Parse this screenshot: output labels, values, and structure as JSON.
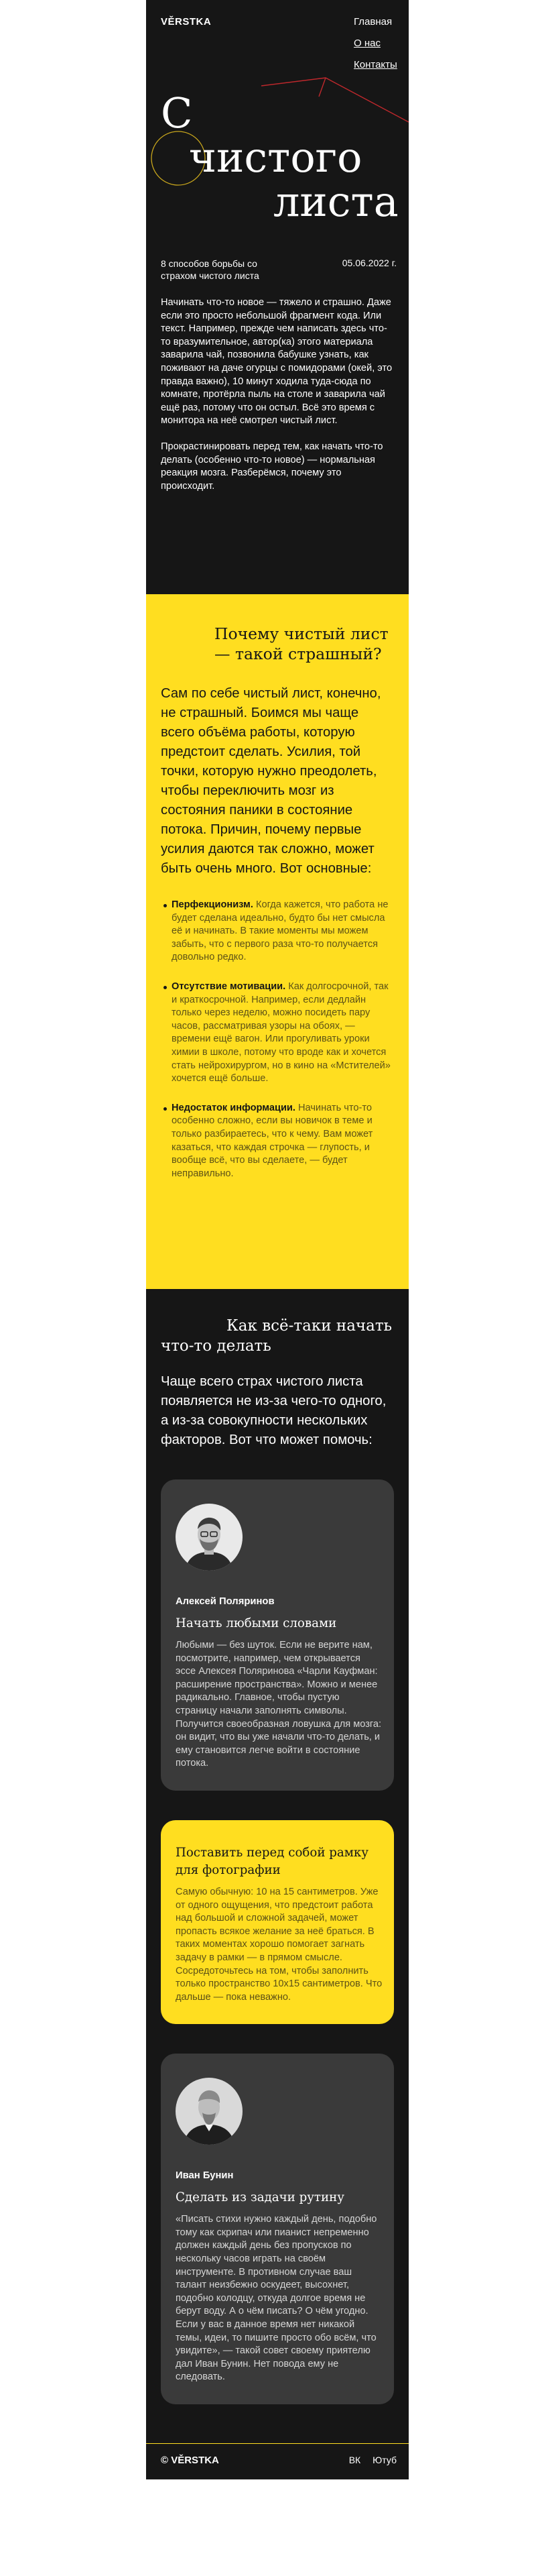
{
  "header": {
    "logo": "VĚRSTKA",
    "nav": [
      "Главная",
      "О нас",
      "Контакты"
    ],
    "title_lines": [
      "С",
      "чистого",
      "листа"
    ],
    "subtitle": "8 способов борьбы со страхом чистого листа",
    "date": "05.06.2022 г."
  },
  "intro": {
    "p1": "Начинать что-то новое — тяжело и страшно. Даже если это просто небольшой фрагмент кода. Или текст. Например, прежде чем написать здесь что-то вразумительное, автор(ка) этого материала заварила чай, позвонила бабушке узнать, как поживают на даче огурцы с помидорами (окей, это правда важно), 10 минут ходила туда-сюда по комнате, протёрла пыль на столе и заварила чай ещё раз, потому что он остыл. Всё это время с монитора на неё смотрел чистый лист.",
    "p2": "Прокрастинировать перед тем, как начать что-то делать (особенно что-то новое) — нормальная реакция мозга. Разберёмся, почему это происходит."
  },
  "why": {
    "heading": "Почему чистый лист — такой страшный?",
    "lead": "Сам по себе чистый лист, конечно, не страшный. Боимся мы чаще всего объёма работы, которую предстоит сделать. Усилия, той точки, которую нужно преодолеть, чтобы переключить мозг из состояния паники в состояние потока. Причин, почему первые усилия даются так сложно, может быть очень много. Вот основные:",
    "items": [
      {
        "term": "Перфекционизм.",
        "text": " Когда кажется, что работа не будет сделана идеально, будто бы нет смысла её и начинать. В такие моменты мы можем забыть, что с первого раза что-то получается довольно редко."
      },
      {
        "term": "Отсутствие мотивации.",
        "text": " Как долгосрочной, так и краткосрочной. Например, если дедлайн только через неделю, можно посидеть пару часов, рассматривая узоры на обоях, — времени ещё вагон. Или прогуливать уроки химии в школе, потому что вроде как и хочется стать нейрохирургом, но в кино на «Мстителей» хочется ещё больше."
      },
      {
        "term": "Недостаток информации.",
        "text": " Начинать что-то особенно сложно, если вы новичок в теме и только разбираетесь, что к чему. Вам может казаться, что каждая строчка — глупость, и вообще всё, что вы сделаете, — будет неправильно."
      }
    ]
  },
  "how": {
    "heading_l1": "Как всё-таки начать",
    "heading_l2": "что-то делать",
    "lead": "Чаще всего страх чистого листа появляется не из-за чего-то одного, а из-за совокупности нескольких факторов. Вот что может помочь:"
  },
  "cards": [
    {
      "author": "Алексей Поляринов",
      "title": "Начать любыми словами",
      "text": "Любыми — без шуток. Если не верите нам, посмотрите, например, чем открывается эссе Алексея Поляринова «Чарли Кауфман: расширение пространства». Можно и менее радикально. Главное, чтобы пустую страницу начали заполнять символы. Получится своеобразная ловушка для мозга: он видит, что вы уже начали что-то делать, и ему становится легче войти в состояние потока."
    },
    {
      "title": "Поставить перед собой рамку для фотографии",
      "text": "Самую обычную: 10 на 15 сантиметров. Уже от одного ощущения, что предстоит работа над большой и сложной задачей, может пропасть всякое желание за неё браться. В таких моментах хорошо помогает загнать задачу в рамки — в прямом смысле. Сосредоточьтесь на том, чтобы заполнить только пространство 10х15 сантиметров. Что дальше — пока неважно."
    },
    {
      "author": "Иван Бунин",
      "title": "Сделать из задачи рутину",
      "text": "«Писать стихи нужно каждый день, подобно тому как скрипач или пианист непременно должен каждый день без пропусков по нескольку часов играть на своём инструменте. В противном случае ваш талант неизбежно оскудеет, высохнет, подобно колодцу, откуда долгое время не берут воду. А о чём писать? О чём угодно. Если у вас в данное время нет никакой темы, идеи, то пишите просто обо всём, что увидите», — такой совет своему приятелю дал Иван Бунин. Нет повода ему не следовать."
    }
  ],
  "footer": {
    "logo": "© VĚRSTKA",
    "links": [
      "ВК",
      "Ютуб"
    ]
  },
  "colors": {
    "background": "#161616",
    "accent_yellow": "#ffde20",
    "card_dark": "#3a3a3a",
    "deco_red": "#c0282c",
    "deco_yellow": "#ffde20"
  }
}
